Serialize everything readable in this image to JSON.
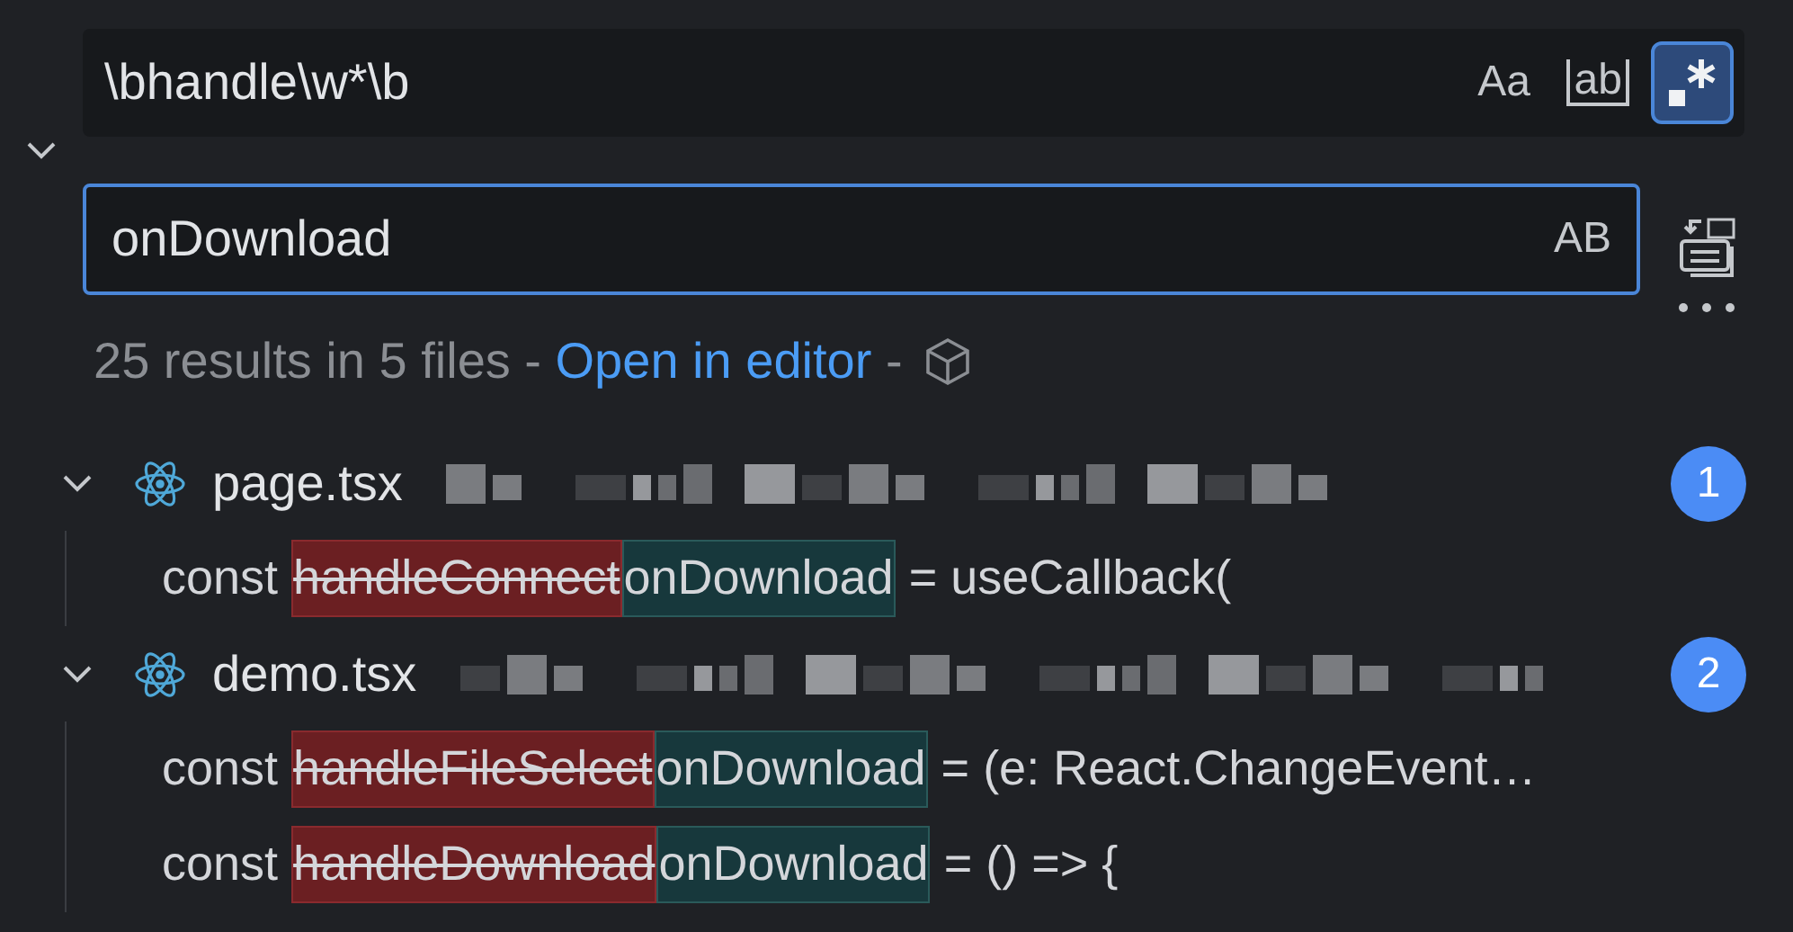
{
  "find": {
    "expanded": true,
    "value": "\\bhandle\\w*\\b",
    "toggles": [
      {
        "kind": "text",
        "label": "Aa",
        "selected": false
      },
      {
        "kind": "whole_word",
        "label": "ab",
        "selected": false
      },
      {
        "kind": "regex",
        "selected": true
      }
    ]
  },
  "replace": {
    "value": "onDownload",
    "toggles": [
      {
        "label": "AB",
        "selected": false
      }
    ]
  },
  "summary": {
    "text": "25 results in 5 files - ",
    "link": "Open in editor",
    "separator": " -"
  },
  "files": [
    {
      "name": "page.tsx",
      "count": "1",
      "expanded": true,
      "matches": [
        {
          "prefix": "const ",
          "removed": "handleConnect",
          "inserted": "onDownload",
          "suffix": " = useCallback("
        }
      ]
    },
    {
      "name": "demo.tsx",
      "count": "2",
      "expanded": true,
      "matches": [
        {
          "prefix": "const ",
          "removed": "handleFileSelect",
          "inserted": "onDownload",
          "suffix": " = (e: React.ChangeEvent…"
        },
        {
          "prefix": "const ",
          "removed": "handleDownload",
          "inserted": "onDownload",
          "suffix": " = () => {"
        }
      ]
    }
  ]
}
